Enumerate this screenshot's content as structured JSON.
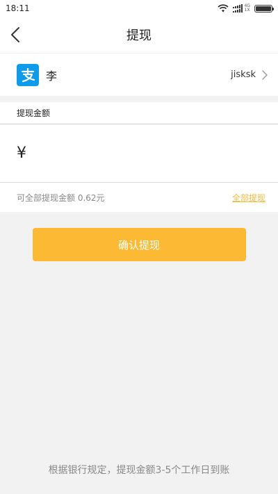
{
  "status_bar": {
    "time": "18:11",
    "network_type": "4G",
    "network_sub": "1X"
  },
  "nav": {
    "title": "提现",
    "back_icon": "chevron-left-icon"
  },
  "account": {
    "icon": "alipay-icon",
    "name": "李",
    "id": "jisksk",
    "chevron_icon": "chevron-right-icon"
  },
  "amount": {
    "label": "提现金额",
    "currency_symbol": "¥",
    "input_value": "",
    "available_text": "可全部提现金额 0.62元",
    "withdraw_all_label": "全部提现"
  },
  "confirm_label": "确认提现",
  "notice": "根据银行规定，提现金额3-5个工作日到账",
  "colors": {
    "accent": "#fbb934",
    "link": "#f5b93c",
    "alipay_blue": "#0e9cea",
    "background": "#f2f2f2"
  }
}
